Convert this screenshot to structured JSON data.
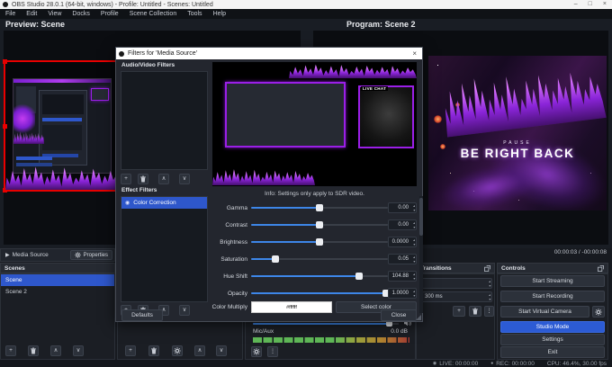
{
  "window": {
    "title": "OBS Studio 28.0.1 (64-bit, windows) - Profile: Untitled - Scenes: Untitled"
  },
  "icons": {
    "minimize": "–",
    "maximize": "□",
    "close": "×",
    "play": "▶",
    "plus": "+",
    "up": "∧",
    "down": "∨",
    "kebab": "⋮",
    "eye": "◉",
    "record_dot": "●",
    "live_dot": "◉",
    "spin_up": "▴",
    "spin_down": "▾"
  },
  "menu": {
    "items": [
      "File",
      "Edit",
      "View",
      "Docks",
      "Profile",
      "Scene Collection",
      "Tools",
      "Help"
    ]
  },
  "preview": {
    "label": "Preview: Scene"
  },
  "program": {
    "label": "Program: Scene 2",
    "art": {
      "pause": "PAUSE",
      "brb": "BE RIGHT BACK"
    }
  },
  "media_controls": {
    "time": "00:00:03 / -00:00:08"
  },
  "source_toolbar": {
    "source": "Media Source",
    "properties": "Properties"
  },
  "dialog": {
    "title": "Filters for 'Media Source'",
    "audio_filters_heading": "Audio/Video Filters",
    "effect_filters_heading": "Effect Filters",
    "effect_filters": [
      {
        "label": "Color Correction",
        "selected": true
      }
    ],
    "preview_overlay": {
      "live_chat": "LIVE CHAT"
    },
    "info": "Info: Settings only apply to SDR video.",
    "sliders": [
      {
        "label": "Gamma",
        "value": "0.00",
        "pct": 50
      },
      {
        "label": "Contrast",
        "value": "0.00",
        "pct": 50
      },
      {
        "label": "Brightness",
        "value": "0.0000",
        "pct": 50
      },
      {
        "label": "Saturation",
        "value": "0.05",
        "pct": 18
      },
      {
        "label": "Hue Shift",
        "value": "104.88",
        "pct": 79
      },
      {
        "label": "Opacity",
        "value": "1.0000",
        "pct": 99
      }
    ],
    "color_multiply": {
      "label": "Color Multiply",
      "hex": "#ffffff",
      "select_button": "Select color"
    },
    "defaults_button": "Defaults",
    "close_button": "Close"
  },
  "scenes": {
    "title": "Scenes",
    "items": [
      {
        "name": "Scene",
        "selected": true
      },
      {
        "name": "Scene 2",
        "selected": false
      }
    ]
  },
  "mixer": {
    "channel": "Mic/Aux",
    "db": "0.0 dB",
    "volume_pct": 93
  },
  "transitions": {
    "title": "Transitions",
    "duration": "300 ms"
  },
  "controls": {
    "title": "Controls",
    "buttons": [
      "Start Streaming",
      "Start Recording",
      "Start Virtual Camera",
      "Studio Mode",
      "Settings",
      "Exit"
    ],
    "active": "Studio Mode"
  },
  "statusbar": {
    "live": "LIVE: 00:00:00",
    "rec": "REC: 00:00:00",
    "stats": "CPU: 46.4%, 30.00 fps"
  },
  "colors": {
    "accent_blue": "#3d86e8",
    "selection_blue": "#2e57cb",
    "overlay_purple": "#9b1fe8",
    "selection_border_red": "#e80000"
  }
}
